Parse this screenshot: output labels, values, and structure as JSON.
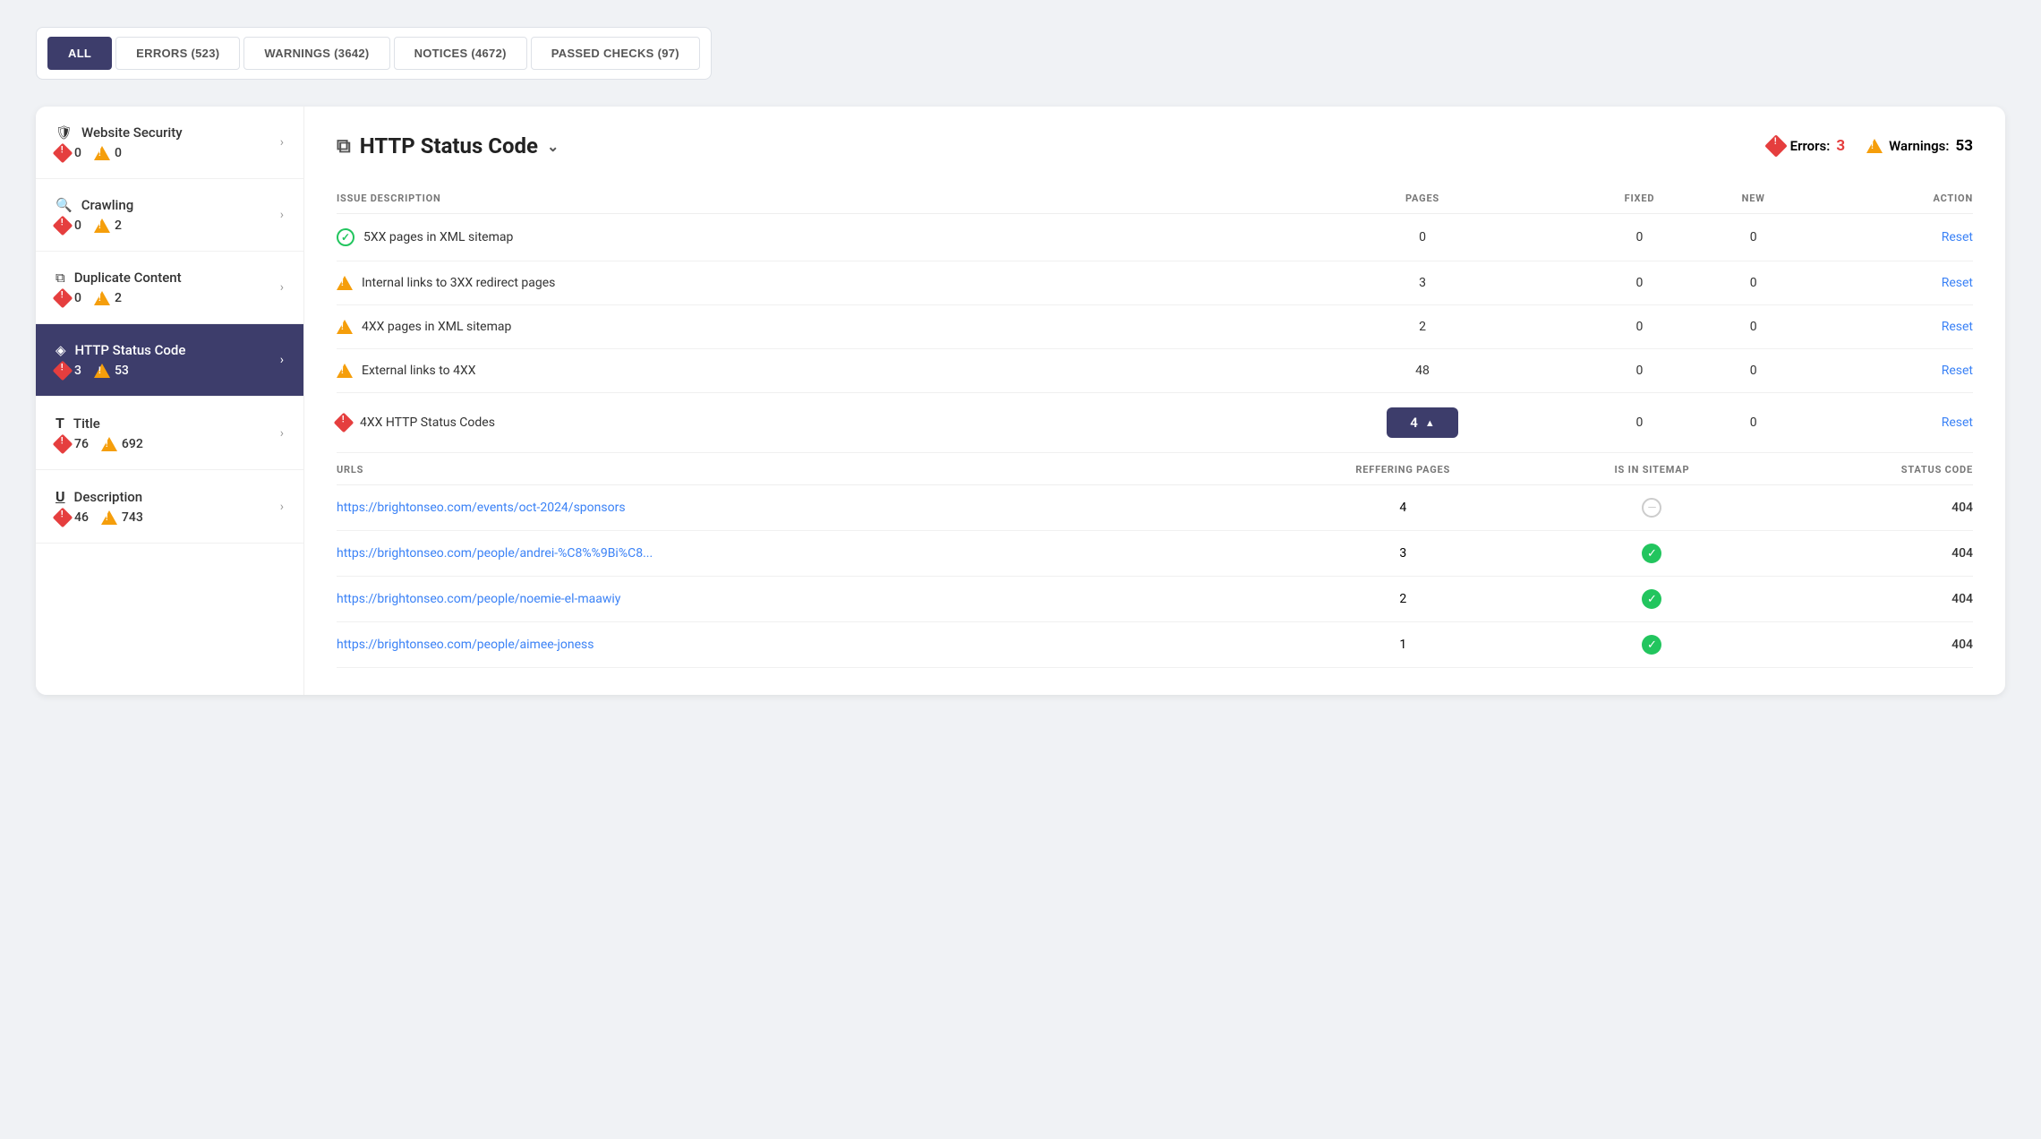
{
  "filter_bar": {
    "tabs": [
      {
        "id": "all",
        "label": "ALL",
        "active": true
      },
      {
        "id": "errors",
        "label": "ERRORS (523)",
        "active": false
      },
      {
        "id": "warnings",
        "label": "WARNINGS (3642)",
        "active": false
      },
      {
        "id": "notices",
        "label": "NOTICES (4672)",
        "active": false
      },
      {
        "id": "passed",
        "label": "PASSED CHECKS (97)",
        "active": false
      }
    ]
  },
  "sidebar": {
    "items": [
      {
        "id": "website-security",
        "icon": "shield",
        "title": "Website Security",
        "errors": 0,
        "warnings": 0,
        "active": false
      },
      {
        "id": "crawling",
        "icon": "search",
        "title": "Crawling",
        "errors": 0,
        "warnings": 2,
        "active": false
      },
      {
        "id": "duplicate-content",
        "icon": "copy",
        "title": "Duplicate Content",
        "errors": 0,
        "warnings": 2,
        "active": false
      },
      {
        "id": "http-status-code",
        "icon": "shield-status",
        "title": "HTTP Status Code",
        "errors": 3,
        "warnings": 53,
        "active": true
      },
      {
        "id": "title",
        "icon": "text",
        "title": "Title",
        "errors": 76,
        "warnings": 692,
        "active": false
      },
      {
        "id": "description",
        "icon": "underline",
        "title": "Description",
        "errors": 46,
        "warnings": 743,
        "active": false
      }
    ]
  },
  "section": {
    "title": "HTTP Status Code",
    "errors_label": "Errors:",
    "errors_count": "3",
    "warnings_label": "Warnings:",
    "warnings_count": "53"
  },
  "table": {
    "columns": {
      "issue_description": "ISSUE DESCRIPTION",
      "pages": "PAGES",
      "fixed": "FIXED",
      "new": "NEW",
      "action": "ACTION"
    },
    "rows": [
      {
        "icon": "check-green",
        "description": "5XX pages in XML sitemap",
        "pages": "0",
        "fixed": "0",
        "new": "0",
        "action": "Reset"
      },
      {
        "icon": "warning",
        "description": "Internal links to 3XX redirect pages",
        "pages": "3",
        "fixed": "0",
        "new": "0",
        "action": "Reset"
      },
      {
        "icon": "warning",
        "description": "4XX pages in XML sitemap",
        "pages": "2",
        "fixed": "0",
        "new": "0",
        "action": "Reset"
      },
      {
        "icon": "warning",
        "description": "External links to 4XX",
        "pages": "48",
        "fixed": "0",
        "new": "0",
        "action": "Reset"
      },
      {
        "icon": "error",
        "description": "4XX HTTP Status Codes",
        "pages": "4",
        "expanded": true,
        "fixed": "0",
        "new": "0",
        "action": "Reset"
      }
    ]
  },
  "sub_table": {
    "columns": {
      "urls": "URLS",
      "referring_pages": "REFFERING PAGES",
      "is_in_sitemap": "IS IN SITEMAP",
      "status_code": "STATUS CODE"
    },
    "rows": [
      {
        "url": "https://brightonseo.com/events/oct-2024/sponsors",
        "referring_pages": "4",
        "is_in_sitemap": "dash",
        "status_code": "404"
      },
      {
        "url": "https://brightonseo.com/people/andrei-%C8%%9Bi%C8...",
        "referring_pages": "3",
        "is_in_sitemap": "check",
        "status_code": "404"
      },
      {
        "url": "https://brightonseo.com/people/noemie-el-maawiy",
        "referring_pages": "2",
        "is_in_sitemap": "check",
        "status_code": "404"
      },
      {
        "url": "https://brightonseo.com/people/aimee-joness",
        "referring_pages": "1",
        "is_in_sitemap": "check",
        "status_code": "404"
      }
    ]
  },
  "colors": {
    "active_bg": "#3d3d6b",
    "error_red": "#e53e3e",
    "warning_yellow": "#f59e0b",
    "link_blue": "#3b82f6",
    "success_green": "#22c55e"
  }
}
